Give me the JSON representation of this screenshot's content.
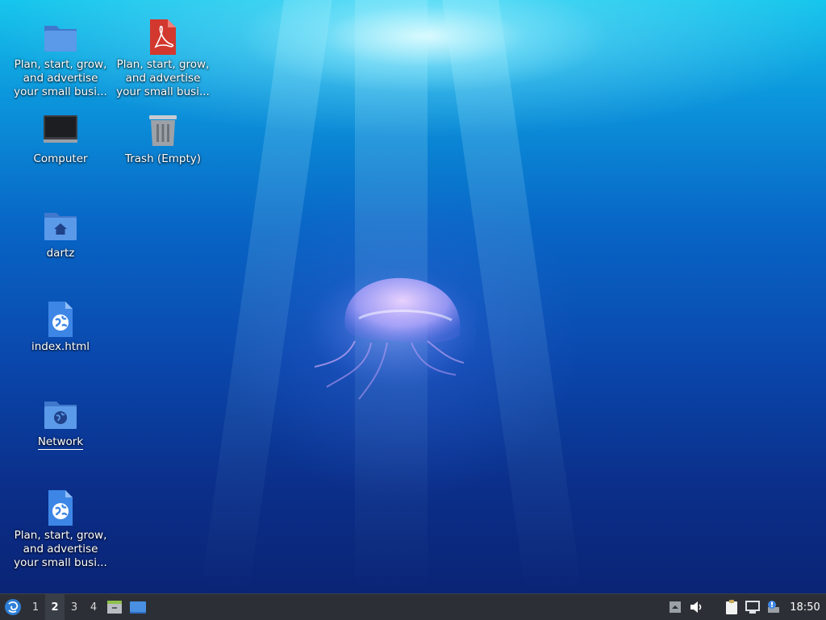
{
  "desktop": {
    "icons": [
      {
        "name": "folder",
        "lines": [
          "Plan, start, grow,",
          "and advertise",
          "your small busi..."
        ]
      },
      {
        "name": "pdf",
        "lines": [
          "Plan, start, grow,",
          "and advertise",
          "your small busi..."
        ]
      },
      {
        "name": "computer",
        "lines": [
          "Computer"
        ]
      },
      {
        "name": "trash",
        "lines": [
          "Trash (Empty)"
        ]
      },
      {
        "name": "home",
        "lines": [
          "dartz"
        ]
      },
      {
        "name": "index",
        "lines": [
          "index.html"
        ]
      },
      {
        "name": "network",
        "lines": [
          "Network"
        ]
      },
      {
        "name": "html",
        "lines": [
          "Plan, start, grow,",
          "and advertise",
          "your small busi..."
        ]
      }
    ]
  },
  "taskbar": {
    "workspaces": [
      "1",
      "2",
      "3",
      "4"
    ],
    "active_workspace": "2",
    "clock": "18:50"
  },
  "colors": {
    "taskbar_bg": "#2c3036",
    "folder_blue": "#4a86d8",
    "pdf_red": "#d2382e"
  }
}
